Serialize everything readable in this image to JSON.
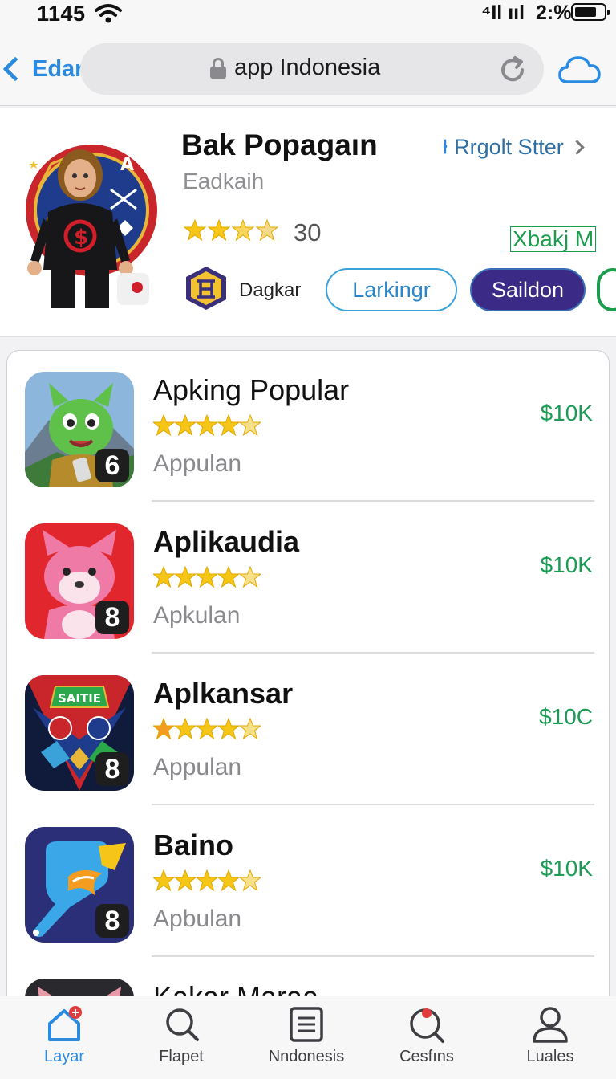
{
  "status": {
    "time": "1145",
    "signal": "⁴Il ııl",
    "battery": "2:%"
  },
  "browser": {
    "back_label": "Edar",
    "url": "app Indonesia"
  },
  "featured": {
    "title": "Bak Popagaın",
    "subtitle": "Eadkaih",
    "rating": "30",
    "link_label": "Rrgolt Stter",
    "link_prefix": "⍿",
    "badge_text": "Xbakj M",
    "developer": "Dagkar",
    "buttons": {
      "outline": "Larkingr",
      "solid": "Saildon"
    }
  },
  "apps": [
    {
      "name": "Apking Popular",
      "subtitle": "Appulan",
      "price": "$10K",
      "badge": "6",
      "stars": 4.5
    },
    {
      "name": "Aplikaudia",
      "subtitle": "Apkulan",
      "price": "$10K",
      "badge": "8",
      "stars": 4.5
    },
    {
      "name": "Aplkansar",
      "subtitle": "Appulan",
      "price": "$10C",
      "badge": "8",
      "stars": 4.5,
      "icon_text": "SAITIE"
    },
    {
      "name": "Baino",
      "subtitle": "Apbulan",
      "price": "$10K",
      "badge": "8",
      "stars": 4.5
    },
    {
      "name": "Kakar Maraa",
      "subtitle": "",
      "price": "",
      "badge": "",
      "stars": 0
    }
  ],
  "tabs": [
    {
      "label": "Layar",
      "icon": "home-icon",
      "active": true
    },
    {
      "label": "Flapet",
      "icon": "search-icon",
      "active": false
    },
    {
      "label": "Nndonesis",
      "icon": "list-icon",
      "active": false
    },
    {
      "label": "Cesfıns",
      "icon": "explore-icon",
      "active": false
    },
    {
      "label": "Luales",
      "icon": "profile-icon",
      "active": false
    }
  ],
  "colors": {
    "accent": "#2a8be0",
    "price": "#1b9c55",
    "solid_button": "#3b2a86",
    "star": "#f5c518"
  }
}
